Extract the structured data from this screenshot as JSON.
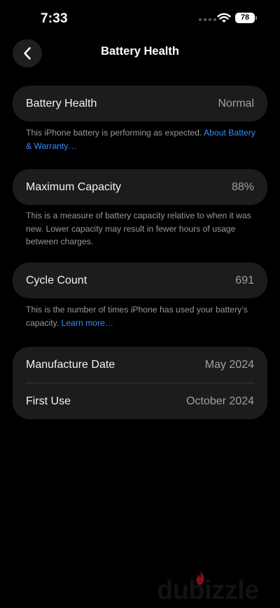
{
  "status_bar": {
    "time": "7:33",
    "battery_level": "78",
    "icons": [
      "signal-dots-icon",
      "wifi-icon",
      "battery-icon"
    ]
  },
  "nav": {
    "back_icon": "chevron-left-icon",
    "title": "Battery Health"
  },
  "sections": {
    "health": {
      "label": "Battery Health",
      "value": "Normal",
      "footnote_text": "This iPhone battery is performing as expected. ",
      "footnote_link": "About Battery & Warranty…"
    },
    "capacity": {
      "label": "Maximum Capacity",
      "value": "88%",
      "footnote_text": "This is a measure of battery capacity relative to when it was new. Lower capacity may result in fewer hours of usage between charges."
    },
    "cycles": {
      "label": "Cycle Count",
      "value": "691",
      "footnote_text": "This is the number of times iPhone has used your battery’s capacity. ",
      "footnote_link": "Learn more…"
    },
    "dates": {
      "manufacture_label": "Manufacture Date",
      "manufacture_value": "May 2024",
      "first_use_label": "First Use",
      "first_use_value": "October 2024"
    }
  },
  "watermark": {
    "text": "dubizzle",
    "flame_color": "#e0242e"
  },
  "colors": {
    "background": "#000000",
    "card": "#1c1c1e",
    "link": "#3a8cff",
    "secondary_text": "#98989d"
  }
}
